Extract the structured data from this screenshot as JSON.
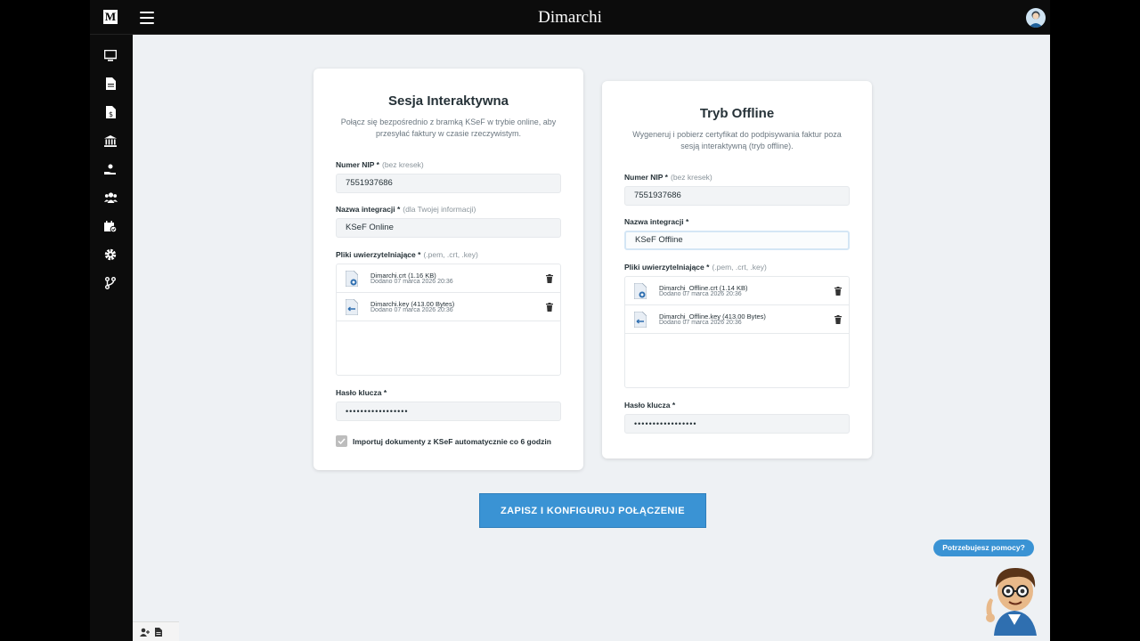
{
  "app": {
    "brand": "Dimarchi",
    "logo_letter": "M"
  },
  "sidebar": {
    "items": [
      {
        "icon": "monitor-icon"
      },
      {
        "icon": "document-icon"
      },
      {
        "icon": "invoice-dollar-icon"
      },
      {
        "icon": "bank-icon"
      },
      {
        "icon": "hand-coin-icon"
      },
      {
        "icon": "users-icon"
      },
      {
        "icon": "calendar-check-icon"
      },
      {
        "icon": "gear-icon"
      },
      {
        "icon": "git-branch-icon"
      }
    ]
  },
  "online": {
    "title": "Sesja Interaktywna",
    "description": "Połącz się bezpośrednio z bramką KSeF w trybie online, aby przesyłać faktury w czasie rzeczywistym.",
    "nip_label": "Numer NIP *",
    "nip_hint": "(bez kresek)",
    "nip_value": "7551937686",
    "name_label": "Nazwa integracji *",
    "name_hint": "(dla Twojej informacji)",
    "name_value": "KSeF Online",
    "files_label": "Pliki uwierzytelniające *",
    "files_hint": "(.pem, .crt, .key)",
    "files": [
      {
        "name": "Dimarchi.crt (1.16 KB)",
        "date": "Dodano 07 marca 2026 20:36"
      },
      {
        "name": "Dimarchi.key (413.00 Bytes)",
        "date": "Dodano 07 marca 2026 20:36"
      }
    ],
    "password_label": "Hasło klucza *",
    "password_value": "•••••••••••••••••",
    "import_label": "Importuj dokumenty z KSeF automatycznie co 6 godzin",
    "import_checked": true
  },
  "offline": {
    "title": "Tryb Offline",
    "description": "Wygeneruj i pobierz certyfikat do podpisywania faktur poza sesją interaktywną (tryb offline).",
    "nip_label": "Numer NIP *",
    "nip_hint": "(bez kresek)",
    "nip_value": "7551937686",
    "name_label": "Nazwa integracji *",
    "name_value": "KSeF Offline",
    "files_label": "Pliki uwierzytelniające *",
    "files_hint": "(.pem, .crt, .key)",
    "files": [
      {
        "name": "Dimarchi_Offline.crt (1.14 KB)",
        "date": "Dodano 07 marca 2026 20:36"
      },
      {
        "name": "Dimarchi_Offline.key (413.00 Bytes)",
        "date": "Dodano 07 marca 2026 20:36"
      }
    ],
    "password_label": "Hasło klucza *",
    "password_value": "•••••••••••••••••"
  },
  "save_button": "ZAPISZ I KONFIGURUJ POŁĄCZENIE",
  "help_button": "Potrzebujesz pomocy?",
  "colors": {
    "accent": "#3a93d4",
    "topbar": "#0c0c0c",
    "background": "#eef1f4"
  }
}
